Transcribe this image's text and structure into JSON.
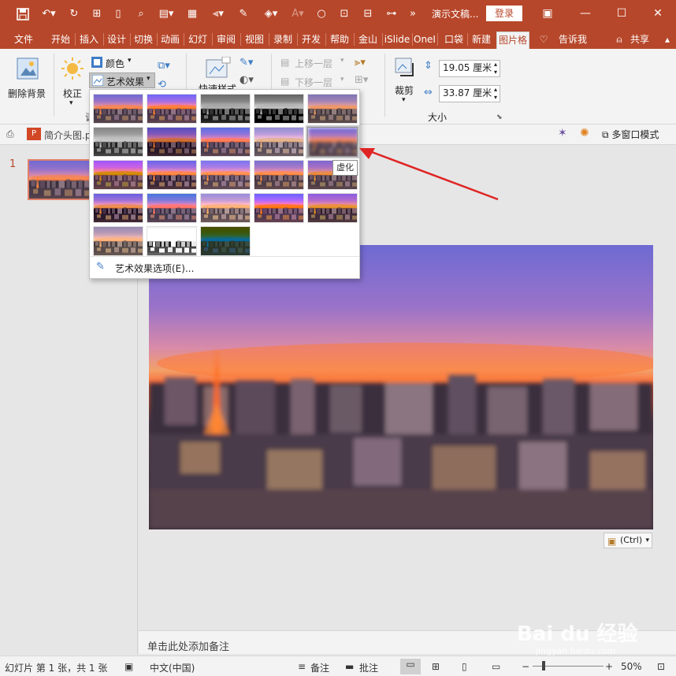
{
  "colors": {
    "accent": "#b7472a",
    "ribbon": "#f3f3f3",
    "canvas_bg": "#e6e6e6",
    "arrow": "#e02424"
  },
  "titlebar": {
    "title": "演示文稿...",
    "login_label": "登录",
    "quick_access_icons": [
      "save-icon",
      "undo-icon",
      "redo-icon",
      "format-painter-icon",
      "new-file-icon",
      "print-preview-icon",
      "open-folder-icon",
      "more-icon",
      "grid-icon",
      "align-icon",
      "eyedropper-icon",
      "fill-icon",
      "font-color-icon",
      "circle-icon",
      "crop-icon",
      "group-icon",
      "forward-icon"
    ],
    "window_controls": [
      "ribbon-display-icon",
      "minimize-icon",
      "maximize-icon",
      "close-icon"
    ]
  },
  "tabs": [
    "文件",
    "开始",
    "插入",
    "设计",
    "切换",
    "动画",
    "幻灯",
    "审阅",
    "视图",
    "录制",
    "开发",
    "帮助",
    "金山",
    "iSlide",
    "OneI",
    "口袋",
    "新建",
    "图片格"
  ],
  "tab_tell_me": "告诉我",
  "tab_share": "共享",
  "ribbon": {
    "remove_bg": "删除背景",
    "corrections": "校正",
    "color": "颜色",
    "artistic_effects": "艺术效果",
    "quick_styles": "快速样式",
    "bring_forward": "上移一层",
    "send_backward": "下移一层",
    "crop": "裁剪",
    "height_value": "19.05 厘米",
    "width_value": "33.87 厘米",
    "size_group": "大小",
    "adjust_group_partial": "调"
  },
  "docstrip": {
    "filename": "简介头图.p",
    "multiwindow": "多窗口模式"
  },
  "thumbnails": {
    "slide_number": "1"
  },
  "gallery": {
    "rows": 5,
    "cols": 5,
    "hovered_index": 9,
    "tooltip": "虚化",
    "options_label": "艺术效果选项(E)..."
  },
  "paste_options": {
    "label": "(Ctrl)"
  },
  "notes": {
    "placeholder": "单击此处添加备注"
  },
  "status": {
    "slide_info": "幻灯片 第 1 张，共 1 张",
    "language": "中文(中国)",
    "notes": "备注",
    "comments": "批注",
    "zoom": "50%"
  },
  "watermark": {
    "brand": "Bai du 经验",
    "url": "jingyan.baidu.com"
  }
}
